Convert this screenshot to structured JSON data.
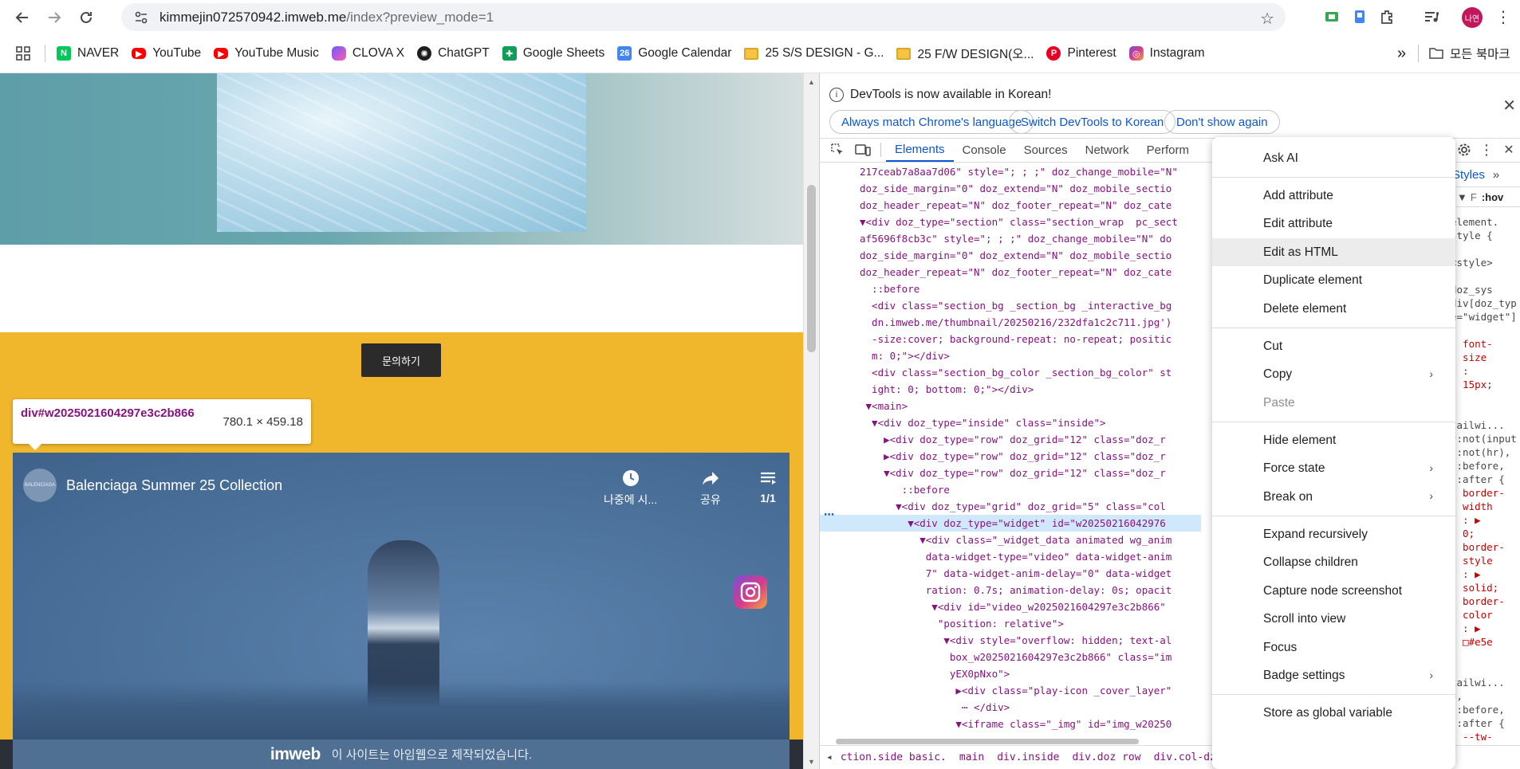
{
  "browser": {
    "url_host": "kimmejin072570942.imweb.me",
    "url_path": "/index?preview_mode=1",
    "avatar_text": "나연",
    "bookmarks": [
      "NAVER",
      "YouTube",
      "YouTube Music",
      "CLOVA X",
      "ChatGPT",
      "Google Sheets",
      "Google Calendar",
      "25 S/S DESIGN - G...",
      "25 F/W DESIGN(오...",
      "Pinterest",
      "Instagram"
    ],
    "all_bookmarks": "모든 북마크",
    "more_glyph": "»"
  },
  "page": {
    "inquiry_button": "문의하기",
    "hover_selector": "div#w2025021604297e3c2b866",
    "hover_dimensions": "780.1 × 459.18",
    "video": {
      "channel_logo_text": "BALENCIAGA",
      "title": "Balenciaga Summer 25 Collection",
      "watch_later": "나중에 시...",
      "share": "공유",
      "playlist_count": "1/1"
    },
    "imweb_logo": "imweb",
    "imweb_text": "이 사이트는 아임웹으로 제작되었습니다."
  },
  "devtools": {
    "info_message": "DevTools is now available in Korean!",
    "info_buttons": [
      "Always match Chrome's language",
      "Switch DevTools to Korean",
      "Don't show again"
    ],
    "tabs": [
      "Elements",
      "Console",
      "Sources",
      "Network",
      "Perform"
    ],
    "styles_tab": "Styles",
    "styles_filter": "F",
    "styles_hov": ":hov",
    "breadcrumbs": [
      "ction.side basic.",
      "main",
      "div.inside",
      "div.doz row",
      "div.col-dz.col-"
    ],
    "dom_lines": [
      "217ceab7a8aa7d06\" style=\"; ; ;\" doz_change_mobile=\"N\"",
      "doz_side_margin=\"0\" doz_extend=\"N\" doz_mobile_sectio",
      "doz_header_repeat=\"N\" doz_footer_repeat=\"N\" doz_cate",
      "▼<div doz_type=\"section\" class=\"section_wrap  pc_sect",
      "af5696f8cb3c\" style=\"; ; ;\" doz_change_mobile=\"N\" do",
      "doz_side_margin=\"0\" doz_extend=\"N\" doz_mobile_sectio",
      "doz_header_repeat=\"N\" doz_footer_repeat=\"N\" doz_cate",
      "  ::before",
      "  <div class=\"section_bg _section_bg _interactive_bg",
      "  dn.imweb.me/thumbnail/20250216/232dfa1c2c711.jpg')",
      "  -size:cover; background-repeat: no-repeat; positic",
      "  m: 0;\"></div>",
      "  <div class=\"section_bg_color _section_bg_color\" st",
      "  ight: 0; bottom: 0;\"></div>",
      " ▼<main>",
      "  ▼<div doz_type=\"inside\" class=\"inside\">",
      "    ▶<div doz_type=\"row\" doz_grid=\"12\" class=\"doz_r",
      "    ▶<div doz_type=\"row\" doz_grid=\"12\" class=\"doz_r",
      "    ▼<div doz_type=\"row\" doz_grid=\"12\" class=\"doz_r",
      "       ::before",
      "      ▼<div doz_type=\"grid\" doz_grid=\"5\" class=\"col",
      "        ▼<div doz_type=\"widget\" id=\"w20250216042976",
      "          ▼<div class=\"_widget_data animated wg_anim",
      "           data-widget-type=\"video\" data-widget-anim",
      "           7\" data-widget-anim-delay=\"0\" data-widget",
      "           ration: 0.7s; animation-delay: 0s; opacit",
      "            ▼<div id=\"video_w2025021604297e3c2b866\"",
      "             \"position: relative\">",
      "              ▼<div style=\"overflow: hidden; text-al",
      "               box_w2025021604297e3c2b866\" class=\"im",
      "               yEX0pNxo\">",
      "                ▶<div class=\"play-icon _cover_layer\"",
      "                 ⋯ </div>",
      "                ▼<iframe class=\"_img\" id=\"img_w20250"
    ],
    "styles_lines": [
      "element.",
      "style {",
      "",
      "<style>",
      ".",
      "doz_sys",
      "div[doz_typ",
      "e=\"widget\"]",
      "{",
      "  font-",
      "  size",
      "  :",
      "  15px;",
      "}",
      "",
      "tailwi...",
      "*:not(input",
      "):not(hr),",
      "::before,",
      "::after {",
      "  border-",
      "  width",
      "  : ▶",
      "  0;",
      "  border-",
      "  style",
      "  : ▶",
      "  solid;",
      "  border-",
      "  color",
      "  : ▶",
      "  □#e5e",
      "}",
      "",
      "tailwi...",
      "*,",
      "::before,",
      "::after {",
      "  --tw-"
    ]
  },
  "context_menu": {
    "groups": [
      [
        "Ask AI"
      ],
      [
        "Add attribute",
        "Edit attribute",
        "Edit as HTML",
        "Duplicate element",
        "Delete element"
      ],
      [
        "Cut",
        "Copy",
        "Paste"
      ],
      [
        "Hide element",
        "Force state",
        "Break on"
      ],
      [
        "Expand recursively",
        "Collapse children",
        "Capture node screenshot",
        "Scroll into view",
        "Focus",
        "Badge settings"
      ],
      [
        "Store as global variable"
      ]
    ],
    "highlighted": "Edit as HTML",
    "disabled": [
      "Paste"
    ],
    "submenu_items": [
      "Copy",
      "Force state",
      "Break on",
      "Badge settings"
    ],
    "submenu_glyph": "›"
  }
}
